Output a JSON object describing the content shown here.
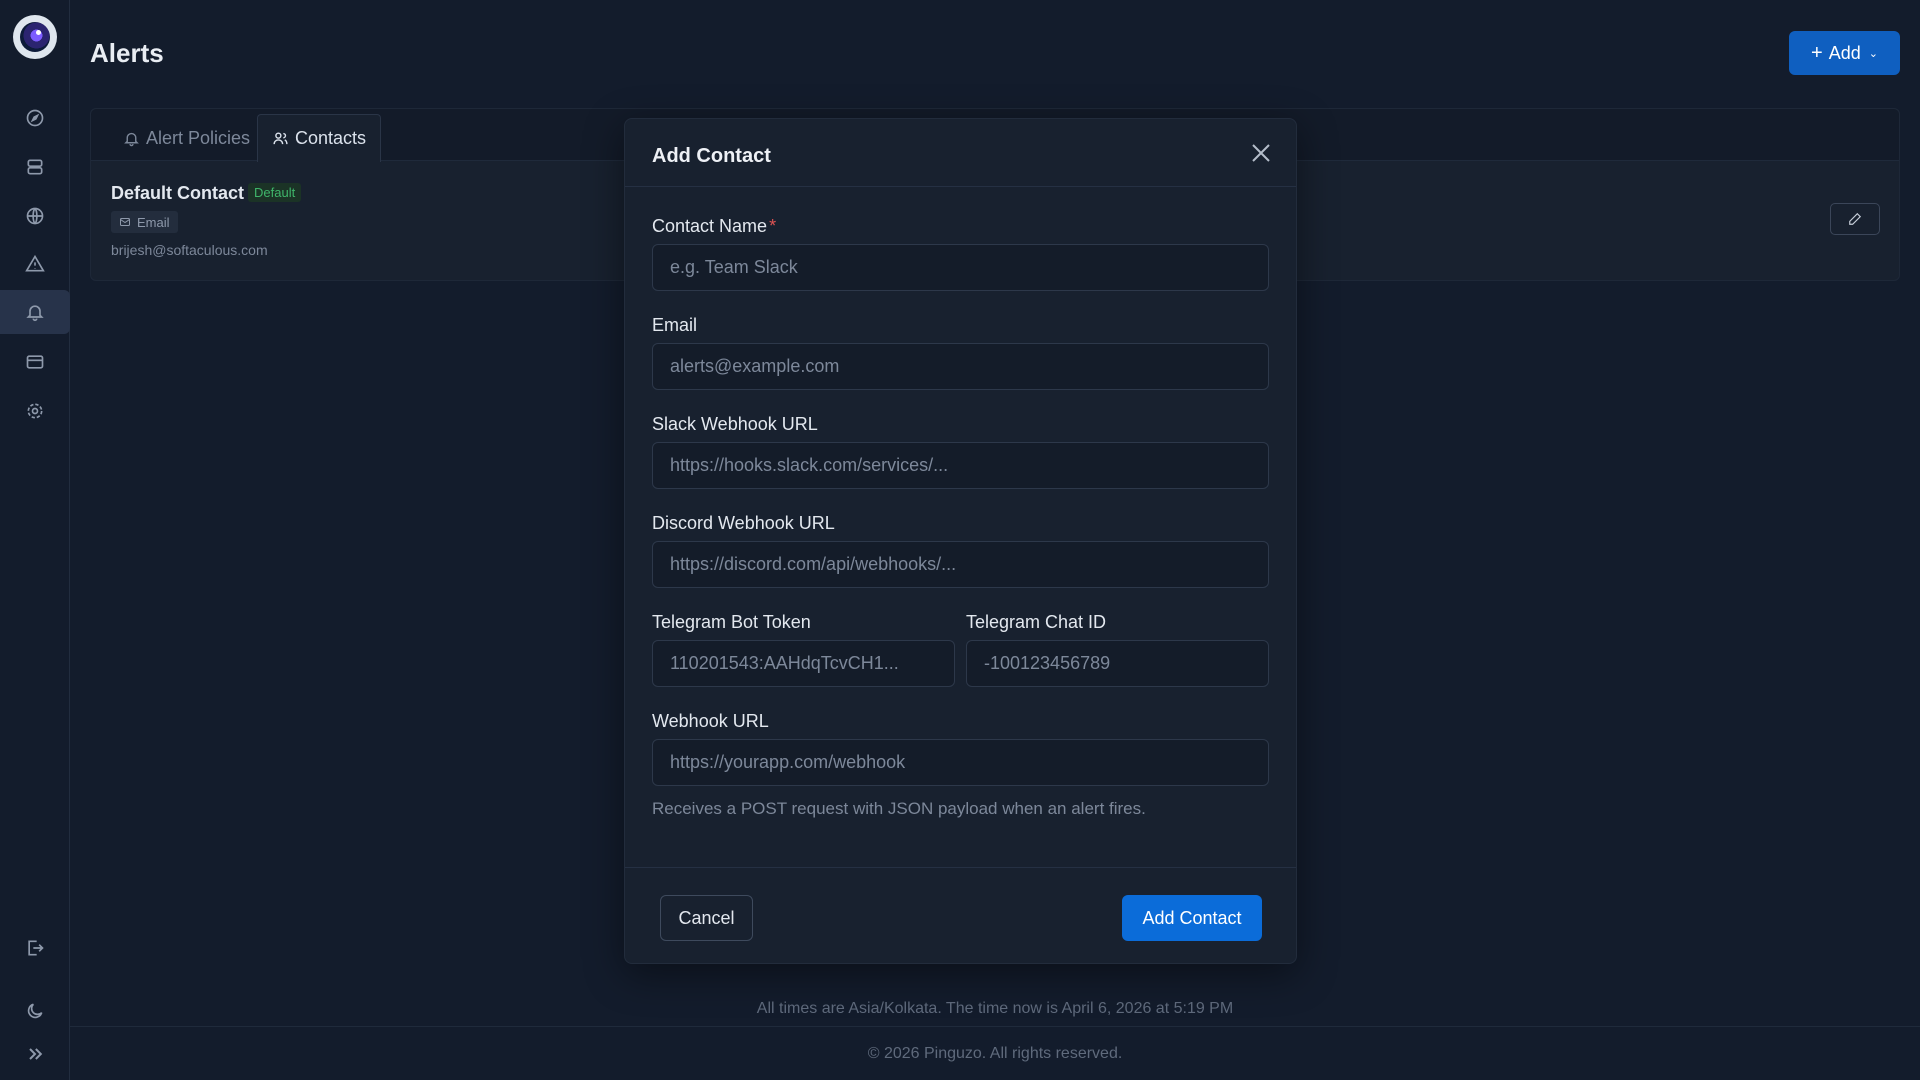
{
  "header": {
    "title": "Alerts",
    "add_label": "Add"
  },
  "sidebar": {
    "items": [
      {
        "name": "dashboard",
        "icon": "compass-icon"
      },
      {
        "name": "servers",
        "icon": "server-icon"
      },
      {
        "name": "websites",
        "icon": "globe-icon"
      },
      {
        "name": "incidents",
        "icon": "warning-icon"
      },
      {
        "name": "alerts",
        "icon": "bell-icon",
        "active": true
      },
      {
        "name": "billing",
        "icon": "credit-card-icon"
      },
      {
        "name": "settings",
        "icon": "gear-icon"
      }
    ],
    "bottom": [
      {
        "name": "logout",
        "icon": "logout-icon"
      },
      {
        "name": "theme",
        "icon": "moon-icon"
      },
      {
        "name": "expand",
        "icon": "chevrons-right-icon"
      }
    ]
  },
  "tabs": [
    {
      "label": "Alert Policies",
      "icon": "bell-icon"
    },
    {
      "label": "Contacts",
      "icon": "users-icon",
      "active": true
    }
  ],
  "contact": {
    "name": "Default Contact",
    "badge": "Default",
    "channel": "Email",
    "email": "brijesh@softaculous.com"
  },
  "modal": {
    "title": "Add Contact",
    "fields": {
      "contact_name": {
        "label": "Contact Name",
        "required_mark": "*",
        "placeholder": "e.g. Team Slack",
        "value": ""
      },
      "email": {
        "label": "Email",
        "placeholder": "alerts@example.com",
        "value": ""
      },
      "slack": {
        "label": "Slack Webhook URL",
        "placeholder": "https://hooks.slack.com/services/...",
        "value": ""
      },
      "discord": {
        "label": "Discord Webhook URL",
        "placeholder": "https://discord.com/api/webhooks/...",
        "value": ""
      },
      "telegram_token": {
        "label": "Telegram Bot Token",
        "placeholder": "110201543:AAHdqTcvCH1...",
        "value": ""
      },
      "telegram_chat": {
        "label": "Telegram Chat ID",
        "placeholder": "-100123456789",
        "value": ""
      },
      "webhook": {
        "label": "Webhook URL",
        "placeholder": "https://yourapp.com/webhook",
        "value": ""
      }
    },
    "hint": "Receives a POST request with JSON payload when an alert fires.",
    "cancel_label": "Cancel",
    "submit_label": "Add Contact"
  },
  "footer": {
    "timezone_note": "All times are Asia/Kolkata. The time now is April 6, 2026 at 5:19 PM",
    "copyright": "© 2026 Pinguzo. All rights reserved."
  },
  "colors": {
    "accent": "#0b6cd9",
    "background": "#131c2c",
    "success": "#3fb56a",
    "required": "#e05353"
  }
}
